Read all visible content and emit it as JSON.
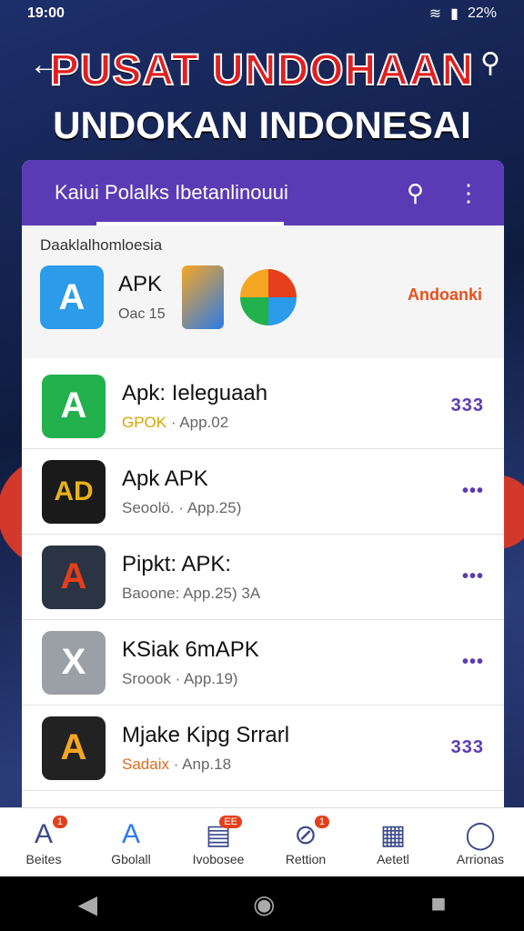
{
  "status": {
    "time": "19:00",
    "battery": "22%"
  },
  "banner": {
    "title_line1": "PUSAT UNDOHAAN",
    "title_line2": "UNDOKAN INDONESAI"
  },
  "card_header": {
    "title": "Kaiui Polalks Ibetanlinouui"
  },
  "featured": {
    "heading": "Daaklalhomloesia",
    "app_name": "APK",
    "app_sub": "Oac 15",
    "cta": "Andoanki"
  },
  "apps": [
    {
      "name": "Apk: Ieleguaah",
      "tag": "GPOK",
      "sub": " · App.02",
      "color": "#22b14c",
      "glyph": "A"
    },
    {
      "name": "Apk APK",
      "tag": "",
      "sub": "Seoolö. · App.25)",
      "color": "#1a1a1a",
      "glyph": "AD"
    },
    {
      "name": "Pipkt: APK:",
      "tag": "",
      "sub": "Baoone: App.25)   3A",
      "color": "#2b3444",
      "glyph": "A"
    },
    {
      "name": "KSiak 6mAPK",
      "tag": "",
      "sub": "Sroook · App.19)",
      "color": "#9aa0a6",
      "glyph": "X"
    },
    {
      "name": "Mjake Kipg Srrarl",
      "tag2": "Sadaix",
      "sub": " · Anp.18",
      "color": "#222222",
      "glyph": "A"
    }
  ],
  "more_labels": [
    "333",
    "•••",
    "•••",
    "•••",
    "333"
  ],
  "bottom_nav": [
    {
      "label": "Beites",
      "icon": "A",
      "badge": "1"
    },
    {
      "label": "Gbolall",
      "icon": "A",
      "badge": ""
    },
    {
      "label": "Ivobosee",
      "icon": "▤",
      "badge": "EE"
    },
    {
      "label": "Rettion",
      "icon": "⊘",
      "badge": "1"
    },
    {
      "label": "Aetetl",
      "icon": "▦",
      "badge": ""
    },
    {
      "label": "Arrionas",
      "icon": "◯",
      "badge": ""
    }
  ]
}
